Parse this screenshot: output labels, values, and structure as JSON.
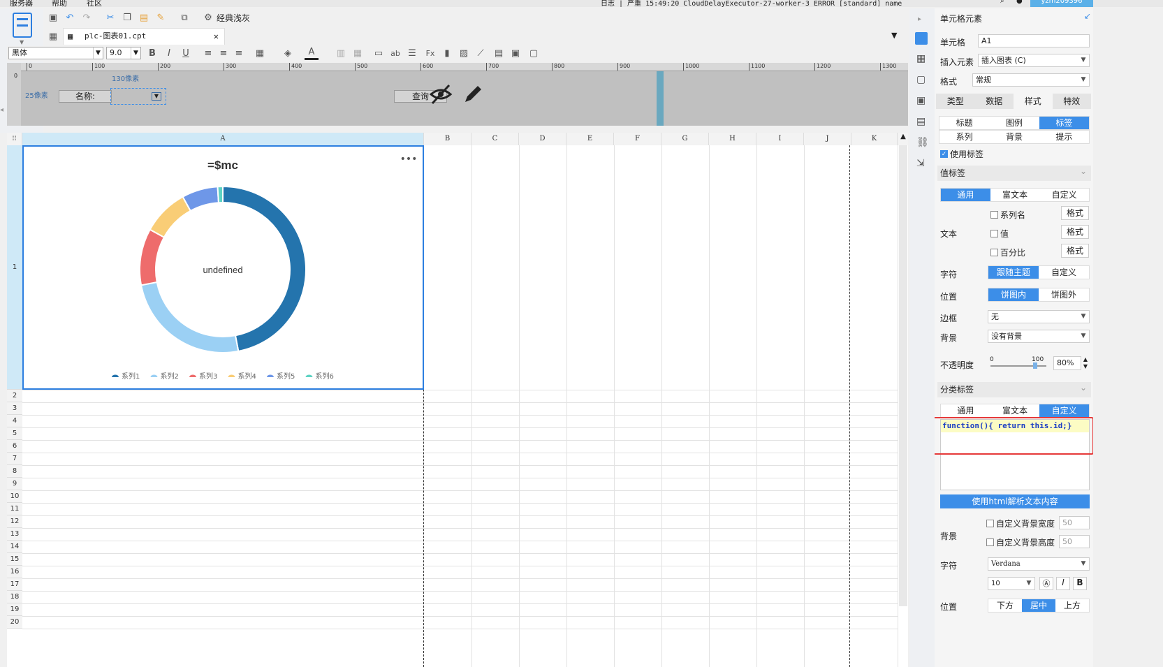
{
  "menubar": {
    "items": [
      "服务器",
      "帮助",
      "社区"
    ],
    "log": "日志 | 严重 15:49:20 CloudDelayExecutor-27-worker-3 ERROR [standard] name",
    "user": "yzm209396"
  },
  "toolbar": {
    "classic_label": "经典浅灰"
  },
  "tab": {
    "title": "plc-图表01.cpt"
  },
  "format_bar": {
    "font": "黑体",
    "size": "9.0"
  },
  "ruler": {
    "ticks": [
      "0",
      "100",
      "200",
      "300",
      "400",
      "500",
      "600",
      "700",
      "800",
      "900",
      "1000",
      "1100",
      "1200",
      "1300"
    ]
  },
  "param_pane": {
    "size_130": "130像素",
    "size_25": "25像素",
    "name_label": "名称:",
    "query_label": "查询"
  },
  "sheet": {
    "columns": [
      "A",
      "B",
      "C",
      "D",
      "E",
      "F",
      "G",
      "H",
      "I",
      "J",
      "K"
    ],
    "rows": [
      "1",
      "2",
      "3",
      "4",
      "5",
      "6",
      "7",
      "8",
      "9",
      "10",
      "11",
      "12",
      "13",
      "14",
      "15",
      "16",
      "17",
      "18",
      "19",
      "20"
    ]
  },
  "chart_data": {
    "type": "pie",
    "donut": true,
    "title": "=$mc",
    "center_label": "undefined",
    "menu_icon": "more-dots",
    "series": [
      {
        "name": "系列1",
        "value": 47,
        "color": "#2474ad"
      },
      {
        "name": "系列2",
        "value": 25,
        "color": "#9bd0f4"
      },
      {
        "name": "系列3",
        "value": 11,
        "color": "#ee6c6c"
      },
      {
        "name": "系列4",
        "value": 9,
        "color": "#f9cd76"
      },
      {
        "name": "系列5",
        "value": 7,
        "color": "#6e97e8"
      },
      {
        "name": "系列6",
        "value": 1,
        "color": "#5fd3c3"
      }
    ],
    "legend_position": "bottom"
  },
  "panel": {
    "header": "单元格元素",
    "cell_label": "单元格",
    "cell_value": "A1",
    "insert_label": "插入元素",
    "insert_value": "插入图表 (C)",
    "format_label": "格式",
    "format_value": "常规",
    "main_tabs": [
      "类型",
      "数据",
      "样式",
      "特效"
    ],
    "sub_tabs_row1": [
      "标题",
      "图例",
      "标签"
    ],
    "sub_tabs_row2": [
      "系列",
      "背景",
      "提示"
    ],
    "use_label": "使用标签",
    "value_label_section": "值标签",
    "value_modes": [
      "通用",
      "富文本",
      "自定义"
    ],
    "text_label": "文本",
    "text_options": [
      "系列名",
      "值",
      "百分比"
    ],
    "fmt_btn": "格式",
    "char_label": "字符",
    "char_modes": [
      "跟随主题",
      "自定义"
    ],
    "pos_label": "位置",
    "pos_modes": [
      "饼图内",
      "饼图外"
    ],
    "border_label": "边框",
    "border_value": "无",
    "bg_label": "背景",
    "bg_value": "没有背景",
    "opacity_label": "不透明度",
    "opacity_min": "0",
    "opacity_max": "100",
    "opacity_value": "80%",
    "opacity_level": 0.8,
    "cat_section": "分类标签",
    "cat_modes": [
      "通用",
      "富文本",
      "自定义"
    ],
    "code": "function(){ return this.id;}",
    "html_btn": "使用html解析文本内容",
    "bg2_label": "背景",
    "custom_w": "自定义背景宽度",
    "custom_h": "自定义背景高度",
    "w_val": "50",
    "h_val": "50",
    "char2_label": "字符",
    "font_value": "Verdana",
    "size_value": "10",
    "pos2_label": "位置",
    "pos2_modes": [
      "下方",
      "居中",
      "上方"
    ]
  },
  "colors": {
    "accent": "#3c8ee8",
    "highlight_box": "#e63a3a"
  }
}
